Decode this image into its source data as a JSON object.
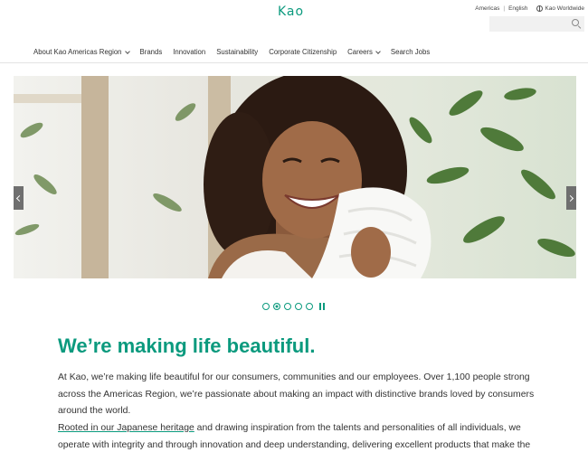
{
  "header": {
    "logo": "Kao",
    "region": "Americas",
    "language": "English",
    "worldwide": "Kao Worldwide",
    "search_placeholder": ""
  },
  "nav": [
    {
      "label": "About Kao Americas Region",
      "has_dropdown": true
    },
    {
      "label": "Brands",
      "has_dropdown": false
    },
    {
      "label": "Innovation",
      "has_dropdown": false
    },
    {
      "label": "Sustainability",
      "has_dropdown": false
    },
    {
      "label": "Corporate Citizenship",
      "has_dropdown": false
    },
    {
      "label": "Careers",
      "has_dropdown": true
    },
    {
      "label": "Search Jobs",
      "has_dropdown": false
    }
  ],
  "carousel": {
    "slide_count": 5,
    "active_slide": 2,
    "image_subject": "smiling woman drying hair with white towel"
  },
  "main": {
    "headline": "We’re making life beautiful.",
    "paragraph1": "At Kao, we’re making life beautiful for our consumers, communities and our employees. Over 1,100 people strong across the Americas Region, we’re passionate about making an impact with distinctive brands loved by consumers around the world.",
    "link_text": "Rooted in our Japanese heritage",
    "paragraph2_rest": " and drawing inspiration from the talents and personalities of all individuals, we operate with integrity and through innovation and deep understanding, delivering excellent products that make the"
  },
  "colors": {
    "brand_green": "#0b9a7e",
    "arrow_bg": "#6f6f6f"
  }
}
